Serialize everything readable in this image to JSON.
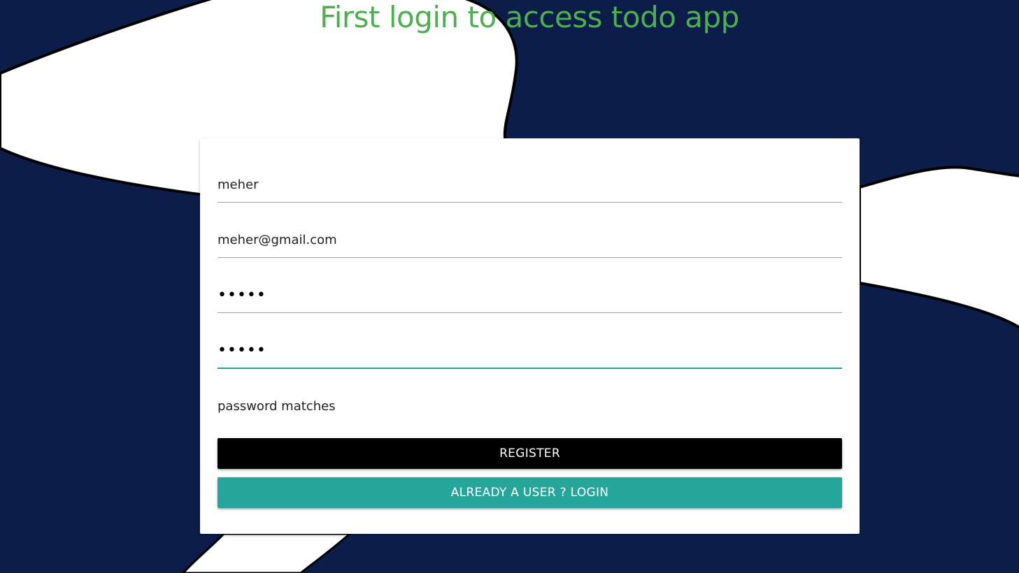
{
  "page": {
    "title": "First login to access todo app"
  },
  "form": {
    "name_value": "meher",
    "email_value": "meher@gmail.com",
    "password_value": "•••••",
    "confirm_password_value": "•••••",
    "status_text": "password matches"
  },
  "buttons": {
    "register_label": "REGISTER",
    "login_label": "ALREADY A USER ? LOGIN"
  },
  "colors": {
    "background": "#0d1d4a",
    "title": "#4caf50",
    "register_button": "#000000",
    "login_button": "#26a69a",
    "focused_underline": "#26a69a"
  }
}
